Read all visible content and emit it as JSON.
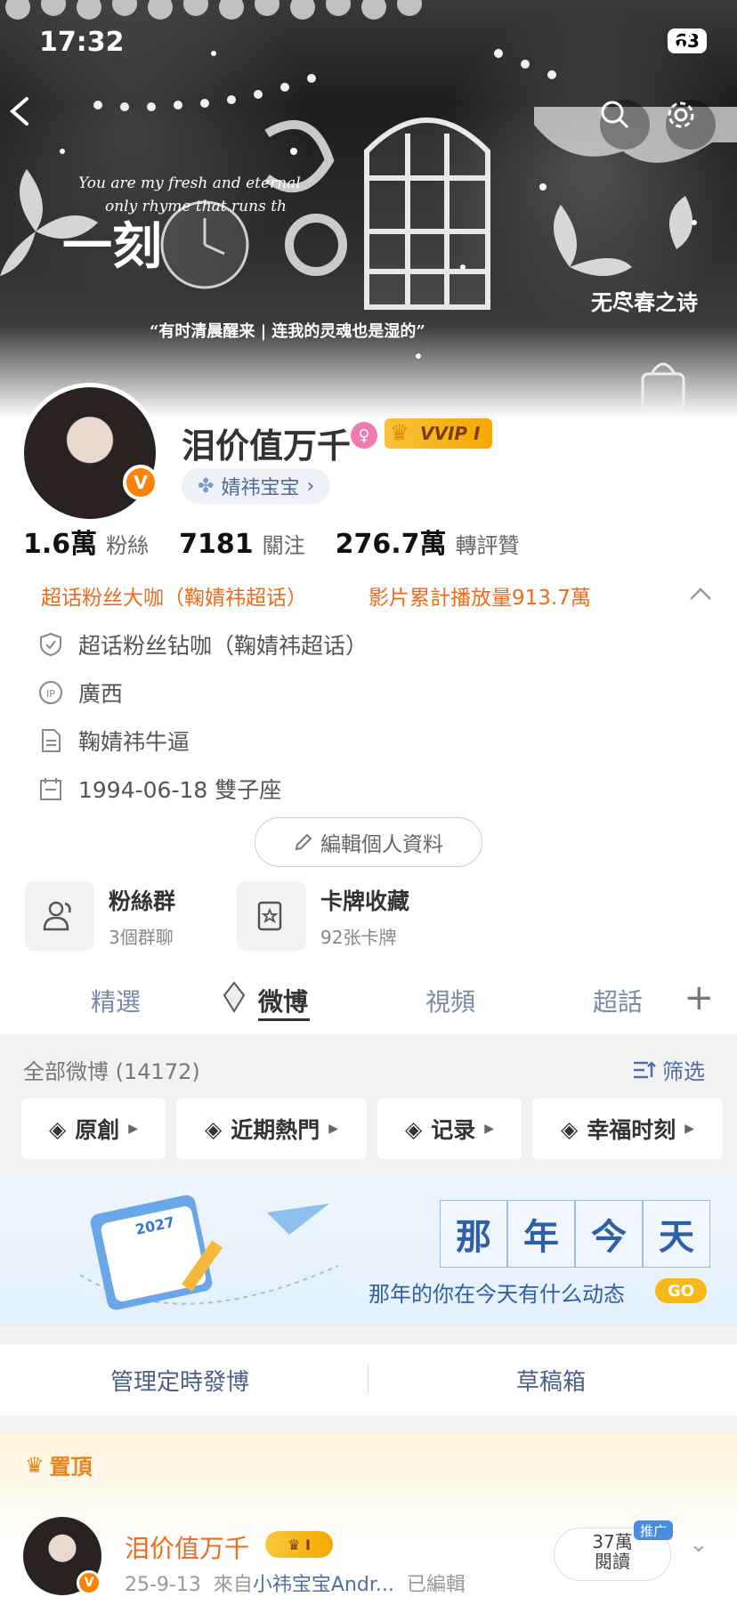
{
  "status_bar": {
    "time": "17:32",
    "battery": "63"
  },
  "banner": {
    "quote_en_line1": "You are my fresh and eternal",
    "quote_en_line2": "only rhyme that runs th",
    "quote_cn": "“有时清晨醒来 | 连我的灵魂也是湿的”",
    "title_cn": "无尽春之诗",
    "big_text": "一刻"
  },
  "profile": {
    "username": "泪价值万千",
    "vip_label": "VVIP I",
    "v_badge": "V",
    "group_chip": "婧祎宝宝",
    "stats": [
      {
        "value": "1.6萬",
        "label": "粉絲"
      },
      {
        "value": "7181",
        "label": "關注"
      },
      {
        "value": "276.7萬",
        "label": "轉評贊"
      }
    ],
    "super_fan": "超话粉丝大咖（鞠婧祎超话）",
    "video_views": "影片累計播放量913.7萬",
    "info": [
      {
        "icon": "shield-icon",
        "text": "超话粉丝钻咖（鞠婧祎超话）"
      },
      {
        "icon": "ip-icon",
        "text": "廣西"
      },
      {
        "icon": "document-icon",
        "text": "鞠婧祎牛逼"
      },
      {
        "icon": "calendar-icon",
        "text": "1994-06-18 雙子座"
      }
    ],
    "edit_label": "編輯個人資料"
  },
  "shortcuts": [
    {
      "title": "粉絲群",
      "subtitle": "3個群聊"
    },
    {
      "title": "卡牌收藏",
      "subtitle": "92张卡牌"
    }
  ],
  "tabs": [
    "精選",
    "微博",
    "視頻",
    "超話"
  ],
  "feed": {
    "all_label": "全部微博 (14172)",
    "filter_label": "筛选",
    "chips": [
      "原創",
      "近期熱門",
      "记录",
      "幸福时刻"
    ],
    "memory": {
      "chars": [
        "那",
        "年",
        "今",
        "天"
      ],
      "subtitle": "那年的你在今天有什么动态",
      "go": "GO",
      "year": "2027"
    },
    "manage_label": "管理定時發博",
    "drafts_label": "草稿箱"
  },
  "pinned": {
    "label": "置頂",
    "author": "泪价值万千",
    "vip": "I",
    "date": "25-9-13",
    "from_prefix": "來自",
    "source": "小祎宝宝Andr...",
    "edited": "已編輯",
    "reads_value": "37萬",
    "reads_label": "閱讀",
    "promo": "推广"
  }
}
